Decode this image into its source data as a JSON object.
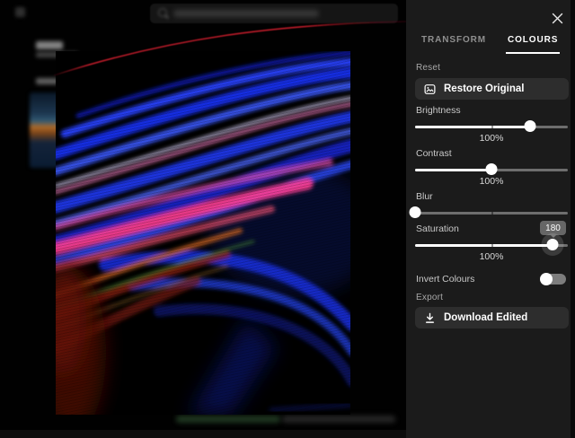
{
  "panel": {
    "tabs": [
      {
        "label": "TRANSFORM",
        "active": false
      },
      {
        "label": "COLOURS",
        "active": true
      }
    ],
    "reset_label": "Reset",
    "restore_button": "Restore Original",
    "sliders": [
      {
        "name": "Brightness",
        "value_label": "100%",
        "position_pct": 75
      },
      {
        "name": "Contrast",
        "value_label": "100%",
        "position_pct": 50
      },
      {
        "name": "Blur",
        "value_label": "",
        "position_pct": 0
      },
      {
        "name": "Saturation",
        "value_label": "100%",
        "position_pct": 90,
        "tooltip": "180",
        "halo": true
      }
    ],
    "invert": {
      "label": "Invert Colours",
      "on": false
    },
    "export_label": "Export",
    "download_button": "Download Edited"
  },
  "icons": {
    "close": "close-icon",
    "restore": "image-icon",
    "download": "download-icon",
    "search": "search-icon"
  },
  "colors": {
    "panel_bg": "#1b1b1b",
    "button_bg": "#2d2d2d",
    "slider_fill": "#ffffff",
    "slider_track": "#6e6e6e",
    "tooltip_bg": "#666666",
    "tab_active": "#ffffff",
    "tab_inactive": "#8f8f8f",
    "photo_blue": "#2742ff",
    "photo_pink": "#ff3d92",
    "photo_red_arc": "#cc1e2c"
  }
}
